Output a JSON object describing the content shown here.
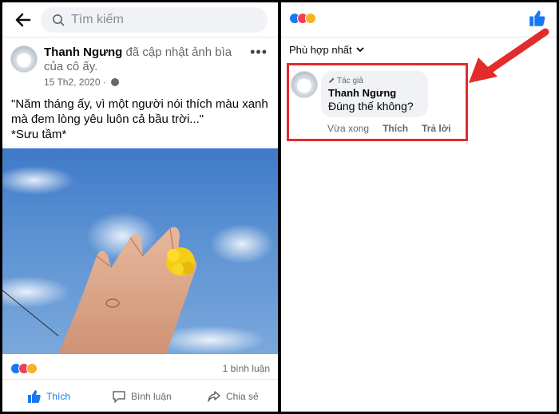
{
  "left": {
    "search_placeholder": "Tìm kiếm",
    "post": {
      "author": "Thanh Ngưng",
      "action_text": " đã cập nhật ảnh bìa của cô ấy.",
      "date": "15 Th2, 2020 · ",
      "more": "•••",
      "text": "\"Năm tháng ấy, vì một người nói thích màu xanh\nmà đem lòng yêu luôn cả bầu trời...\"\n*Sưu tầm*"
    },
    "comment_count": "1 bình luận",
    "actions": {
      "like": "Thích",
      "comment": "Bình luận",
      "share": "Chia sẻ"
    }
  },
  "right": {
    "sort_label": "Phù hợp nhất",
    "comment": {
      "author_tag": "Tác giả",
      "author": "Thanh Ngưng",
      "text": "Đúng thế không?",
      "time": "Vừa xong",
      "like": "Thích",
      "reply": "Trả lời"
    }
  },
  "colors": {
    "accent": "#1877f2",
    "annotation": "#e32b2b",
    "reaction_like": "#1877f2",
    "reaction_love": "#f33e58",
    "reaction_haha": "#f7b125"
  }
}
